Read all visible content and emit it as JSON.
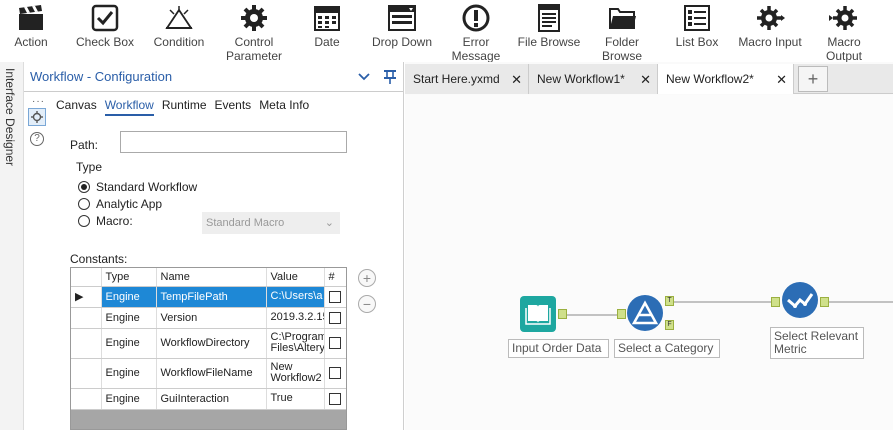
{
  "toolbar": {
    "items": [
      {
        "label": "Action",
        "icon": "clapperboard-icon"
      },
      {
        "label": "Check Box",
        "icon": "check-box-icon"
      },
      {
        "label": "Condition",
        "icon": "condition-icon"
      },
      {
        "label": "Control\nParameter",
        "icon": "gear-icon"
      },
      {
        "label": "Date",
        "icon": "calendar-icon"
      },
      {
        "label": "Drop Down",
        "icon": "drop-down-icon"
      },
      {
        "label": "Error\nMessage",
        "icon": "error-icon"
      },
      {
        "label": "File Browse",
        "icon": "file-icon"
      },
      {
        "label": "Folder\nBrowse",
        "icon": "folder-icon"
      },
      {
        "label": "List Box",
        "icon": "list-box-icon"
      },
      {
        "label": "Macro Input",
        "icon": "macro-input-icon"
      },
      {
        "label": "Macro\nOutput",
        "icon": "macro-output-icon"
      }
    ]
  },
  "left_strip": {
    "label": "Interface Designer"
  },
  "config": {
    "title": "Workflow - Configuration",
    "tabs": [
      "Canvas",
      "Workflow",
      "Runtime",
      "Events",
      "Meta Info"
    ],
    "active_tab": "Workflow",
    "path_label": "Path:",
    "path_value": "",
    "type_label": "Type",
    "types": [
      {
        "label": "Standard Workflow",
        "checked": true
      },
      {
        "label": "Analytic App",
        "checked": false
      },
      {
        "label": "Macro:",
        "checked": false
      }
    ],
    "macro_select": "Standard Macro",
    "constants_label": "Constants:",
    "constants_headers": [
      "Type",
      "Name",
      "Value",
      "#"
    ],
    "constants": [
      {
        "type": "Engine",
        "name": "TempFilePath",
        "value": "C:\\Users\\a",
        "selected": true
      },
      {
        "type": "Engine",
        "name": "Version",
        "value": "2019.3.2.15",
        "selected": false
      },
      {
        "type": "Engine",
        "name": "WorkflowDirectory",
        "value": "C:\\Program\nFiles\\Altery",
        "selected": false
      },
      {
        "type": "Engine",
        "name": "WorkflowFileName",
        "value": "New\nWorkflow2",
        "selected": false
      },
      {
        "type": "Engine",
        "name": "GuiInteraction",
        "value": "True",
        "selected": false
      }
    ]
  },
  "doc_tabs": [
    {
      "label": "Start Here.yxmd",
      "active": false
    },
    {
      "label": "New Workflow1*",
      "active": false
    },
    {
      "label": "New Workflow2*",
      "active": true
    }
  ],
  "canvas": {
    "tools": [
      {
        "label": "Input Order Data",
        "color": "#1ea7a0"
      },
      {
        "label": "Select a Category",
        "color": "#2c6db5"
      },
      {
        "label": "Select Relevant\nMetric",
        "color": "#2c6db5"
      }
    ],
    "connectors": {
      "true": "T",
      "false": "F"
    }
  }
}
